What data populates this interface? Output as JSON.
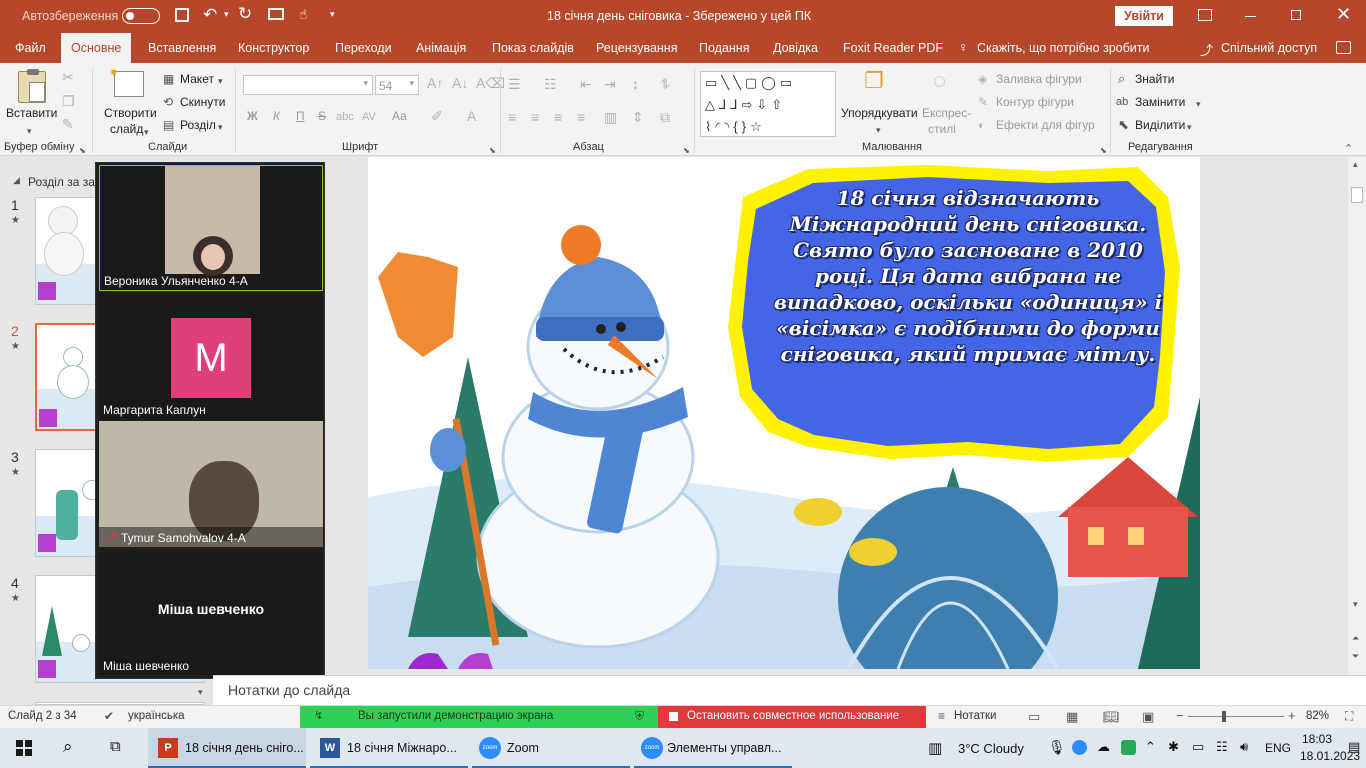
{
  "titlebar": {
    "autosave_label": "Автозбереження",
    "autosave_state": "Вимк.",
    "doc_title": "18 січня день сніговика  -  Збережено у цей ПК",
    "signin_label": "Увійти"
  },
  "tabs": [
    "Файл",
    "Основне",
    "Вставлення",
    "Конструктор",
    "Переходи",
    "Анімація",
    "Показ слайдів",
    "Рецензування",
    "Подання",
    "Довідка",
    "Foxit Reader PDF"
  ],
  "tell_me": "Скажіть, що потрібно зробити",
  "share": "Спільний доступ",
  "ribbon": {
    "clipboard": {
      "paste": "Вставити",
      "label": "Буфер обміну"
    },
    "slides": {
      "new_slide_1": "Створити",
      "new_slide_2": "слайд",
      "layout": "Макет",
      "reset": "Скинути",
      "section": "Розділ",
      "label": "Слайди"
    },
    "font": {
      "font_size": "54",
      "bold": "Ж",
      "italic": "К",
      "underline": "П",
      "strike": "S",
      "case": "Аа",
      "label": "Шрифт"
    },
    "paragraph": {
      "label": "Абзац"
    },
    "drawing": {
      "arrange": "Упорядкувати",
      "quick_styles_1": "Експрес-",
      "quick_styles_2": "стилі",
      "fill": "Заливка фігури",
      "outline": "Контур фігури",
      "effects": "Ефекти для фігур",
      "label": "Малювання"
    },
    "editing": {
      "find": "Знайти",
      "replace": "Замінити",
      "select": "Виділити",
      "label": "Редагування"
    }
  },
  "thumbnails": {
    "section_label": "Розділ за зам",
    "items": [
      {
        "num": "1",
        "star": "★"
      },
      {
        "num": "2",
        "star": "★"
      },
      {
        "num": "3",
        "star": "★"
      },
      {
        "num": "4",
        "star": "★"
      }
    ]
  },
  "zoom": {
    "participants": [
      {
        "name": "Вероника Ульянченко 4-А",
        "type": "video"
      },
      {
        "name": "Маргарита Каплун",
        "type": "avatar",
        "initial": "М",
        "color": "#e0407a"
      },
      {
        "name": "Tymur Samohvalov 4-A",
        "type": "video",
        "muted": true
      },
      {
        "name": "Міша шевченко",
        "type": "name_only",
        "display": "Міша шевченко"
      }
    ]
  },
  "slide": {
    "text_lines": [
      "18 січня відзначають",
      "Міжнародний день сніговика.",
      "Свято було засноване в 2010",
      "році.  Ця дата вибрана не",
      "випадково, оскільки «одиниця» і",
      "«вісімка» є подібними до форми",
      "сніговика, який тримає мітлу."
    ],
    "colors": {
      "bubble": "#4466e6",
      "glow": "#fff200",
      "sky": "#ffffff",
      "snow": "#dcecf8"
    }
  },
  "notes_placeholder": "Нотатки до слайда",
  "status": {
    "slide_counter": "Слайд 2 з 34",
    "language": "українська",
    "zoom_share_msg": "Вы запустили демонстрацию экрана",
    "zoom_stop_msg": "Остановить совместное использование",
    "notes_btn": "Нотатки",
    "zoom_level": "82%"
  },
  "taskbar": {
    "apps": [
      {
        "label": "18 січня день сніго..."
      },
      {
        "label": "18 січня  Міжнаро..."
      },
      {
        "label": "Zoom"
      },
      {
        "label": "Элементы управл..."
      }
    ],
    "weather": "3°C  Cloudy",
    "lang": "ENG",
    "time": "18:03",
    "date": "18.01.2023"
  }
}
